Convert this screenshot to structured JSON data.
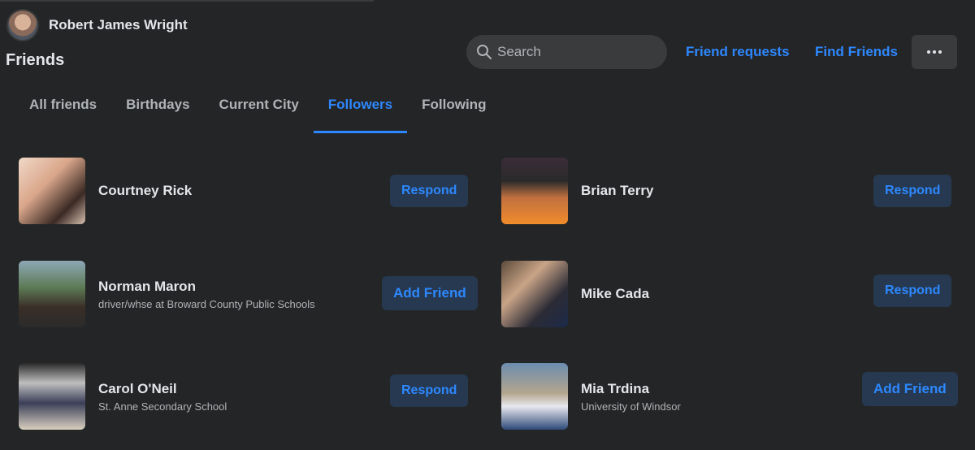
{
  "header": {
    "user_name": "Robert James Wright",
    "page_title": "Friends",
    "search_placeholder": "Search",
    "friend_requests": "Friend requests",
    "find_friends": "Find Friends"
  },
  "tabs": [
    {
      "label": "All friends",
      "active": false
    },
    {
      "label": "Birthdays",
      "active": false
    },
    {
      "label": "Current City",
      "active": false
    },
    {
      "label": "Followers",
      "active": true
    },
    {
      "label": "Following",
      "active": false
    }
  ],
  "people": [
    {
      "name": "Courtney Rick",
      "subtitle": "",
      "action": "Respond"
    },
    {
      "name": "Brian Terry",
      "subtitle": "",
      "action": "Respond"
    },
    {
      "name": "Norman Maron",
      "subtitle": "driver/whse at Broward County Public Schools",
      "action": "Add Friend"
    },
    {
      "name": "Mike Cada",
      "subtitle": "",
      "action": "Respond"
    },
    {
      "name": "Carol O'Neil",
      "subtitle": "St. Anne Secondary School",
      "action": "Respond"
    },
    {
      "name": "Mia Trdina",
      "subtitle": "University of Windsor",
      "action": "Add Friend"
    }
  ],
  "colors": {
    "background": "#242526",
    "accent": "#2d88ff",
    "button_bg": "#263951"
  }
}
